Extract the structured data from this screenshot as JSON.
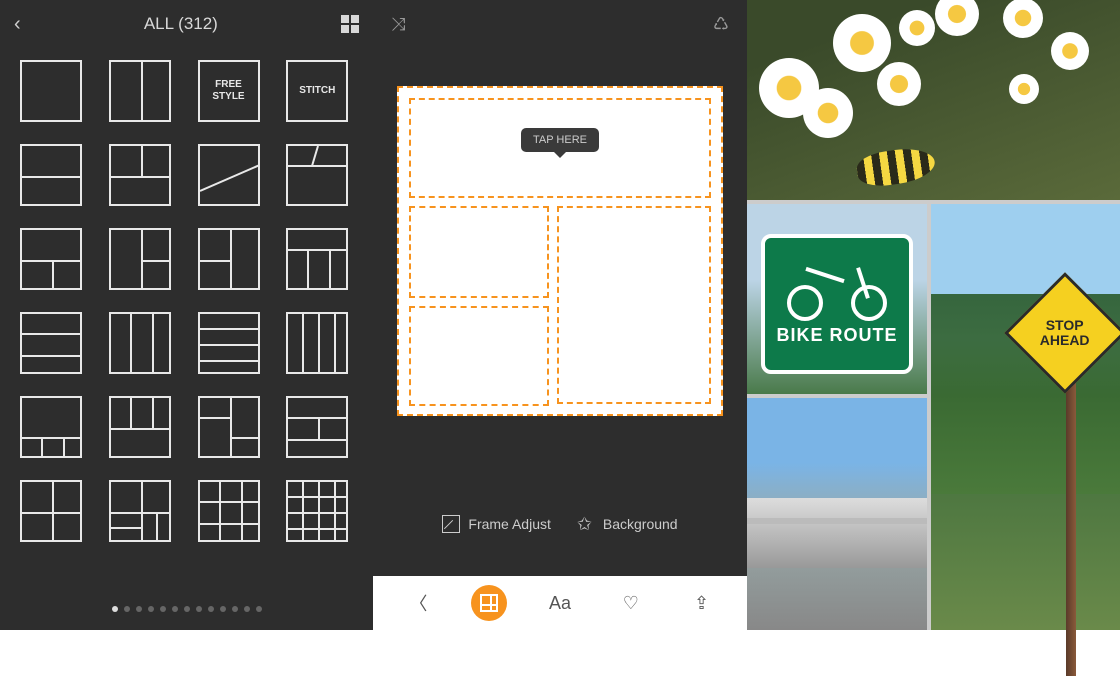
{
  "panel1": {
    "title": "ALL (312)",
    "freeStyle": "FREE\nSTYLE",
    "stitch": "STITCH",
    "pageDots": {
      "count": 13,
      "active": 1
    }
  },
  "panel2": {
    "tooltip": "TAP HERE",
    "frameAdjust": "Frame Adjust",
    "background": "Background",
    "aa": "Aa"
  },
  "panel3": {
    "bikeRoute": "BIKE ROUTE",
    "stopAhead": "STOP\nAHEAD"
  },
  "colors": {
    "accent": "#f7931e"
  }
}
